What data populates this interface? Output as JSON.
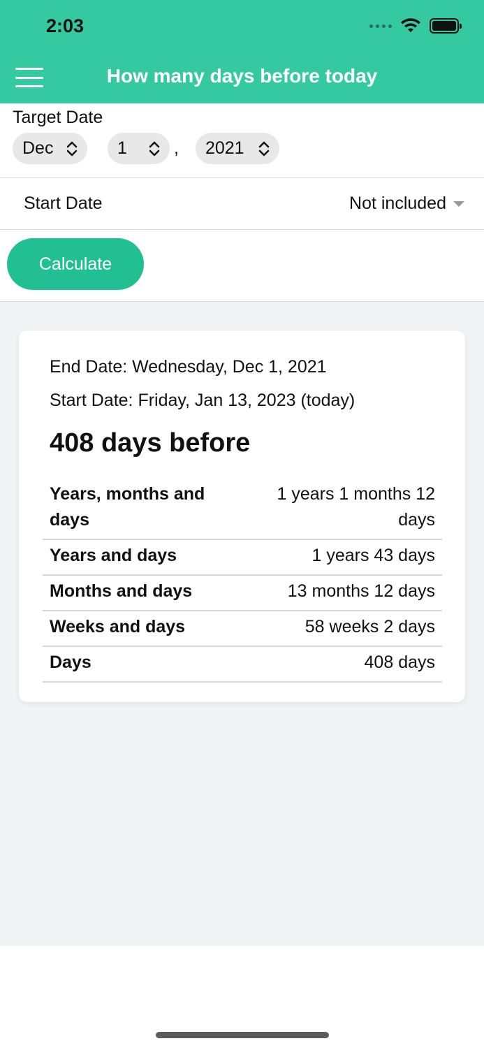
{
  "status_bar": {
    "time": "2:03"
  },
  "header": {
    "title": "How many days before today"
  },
  "target_date": {
    "label": "Target Date",
    "month": "Dec",
    "day": "1",
    "separator": ",",
    "year": "2021"
  },
  "start_date": {
    "label": "Start Date",
    "value": "Not included"
  },
  "calculate_label": "Calculate",
  "result": {
    "end_date": "End Date: Wednesday, Dec 1, 2021",
    "start_date": "Start Date: Friday, Jan 13, 2023 (today)",
    "headline": "408 days before",
    "rows": [
      {
        "key": "Years, months and days",
        "value": "1 years 1 months 12 days"
      },
      {
        "key": "Years and days",
        "value": "1 years 43 days"
      },
      {
        "key": "Months and days",
        "value": "13 months 12 days"
      },
      {
        "key": "Weeks and days",
        "value": "58 weeks 2 days"
      },
      {
        "key": "Days",
        "value": "408 days"
      }
    ]
  },
  "colors": {
    "header": "#34c9a0",
    "button": "#22bf92",
    "background": "#f2f3f7"
  },
  "icons": [
    "menu-icon",
    "wifi-icon",
    "battery-icon",
    "chevron-updown-icon",
    "caret-down-icon"
  ]
}
